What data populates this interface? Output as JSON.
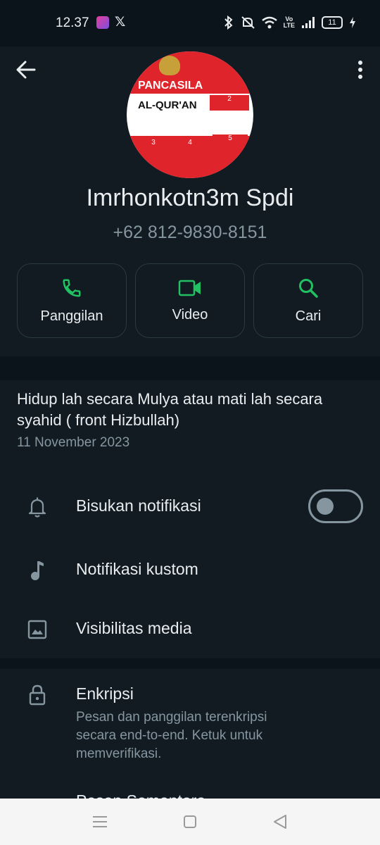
{
  "status_bar": {
    "time": "12.37",
    "x_label": "𝕏",
    "volte_top": "Vo",
    "volte_bottom": "LTE",
    "battery": "11"
  },
  "header": {
    "back_icon": "arrow-left-icon",
    "more_icon": "more-vertical-icon",
    "avatar": {
      "title": "PANCASILA",
      "subtitle": "AL-QUR'AN",
      "cells": [
        "2",
        "3",
        "4",
        "5"
      ]
    },
    "name": "Imrhonkotn3m Spdi",
    "phone": "+62 812-9830-8151"
  },
  "actions": [
    {
      "label": "Panggilan",
      "icon": "phone-icon"
    },
    {
      "label": "Video",
      "icon": "video-icon"
    },
    {
      "label": "Cari",
      "icon": "search-icon"
    }
  ],
  "about": {
    "text": "Hidup lah secara Mulya atau mati lah secara syahid ( front Hizbullah)",
    "date": "11 November 2023"
  },
  "settings": [
    {
      "label": "Bisukan notifikasi",
      "icon": "bell-icon",
      "toggle": false
    },
    {
      "label": "Notifikasi kustom",
      "icon": "music-note-icon"
    },
    {
      "label": "Visibilitas media",
      "icon": "image-icon"
    }
  ],
  "security": {
    "title": "Enkripsi",
    "description": "Pesan dan panggilan terenkripsi secara end-to-end. Ketuk untuk memverifikasi.",
    "next_item": "Pesan Sementara"
  },
  "colors": {
    "background": "#0b141a",
    "surface": "#111b21",
    "accent": "#21c063",
    "secondary_text": "#8696a0"
  }
}
